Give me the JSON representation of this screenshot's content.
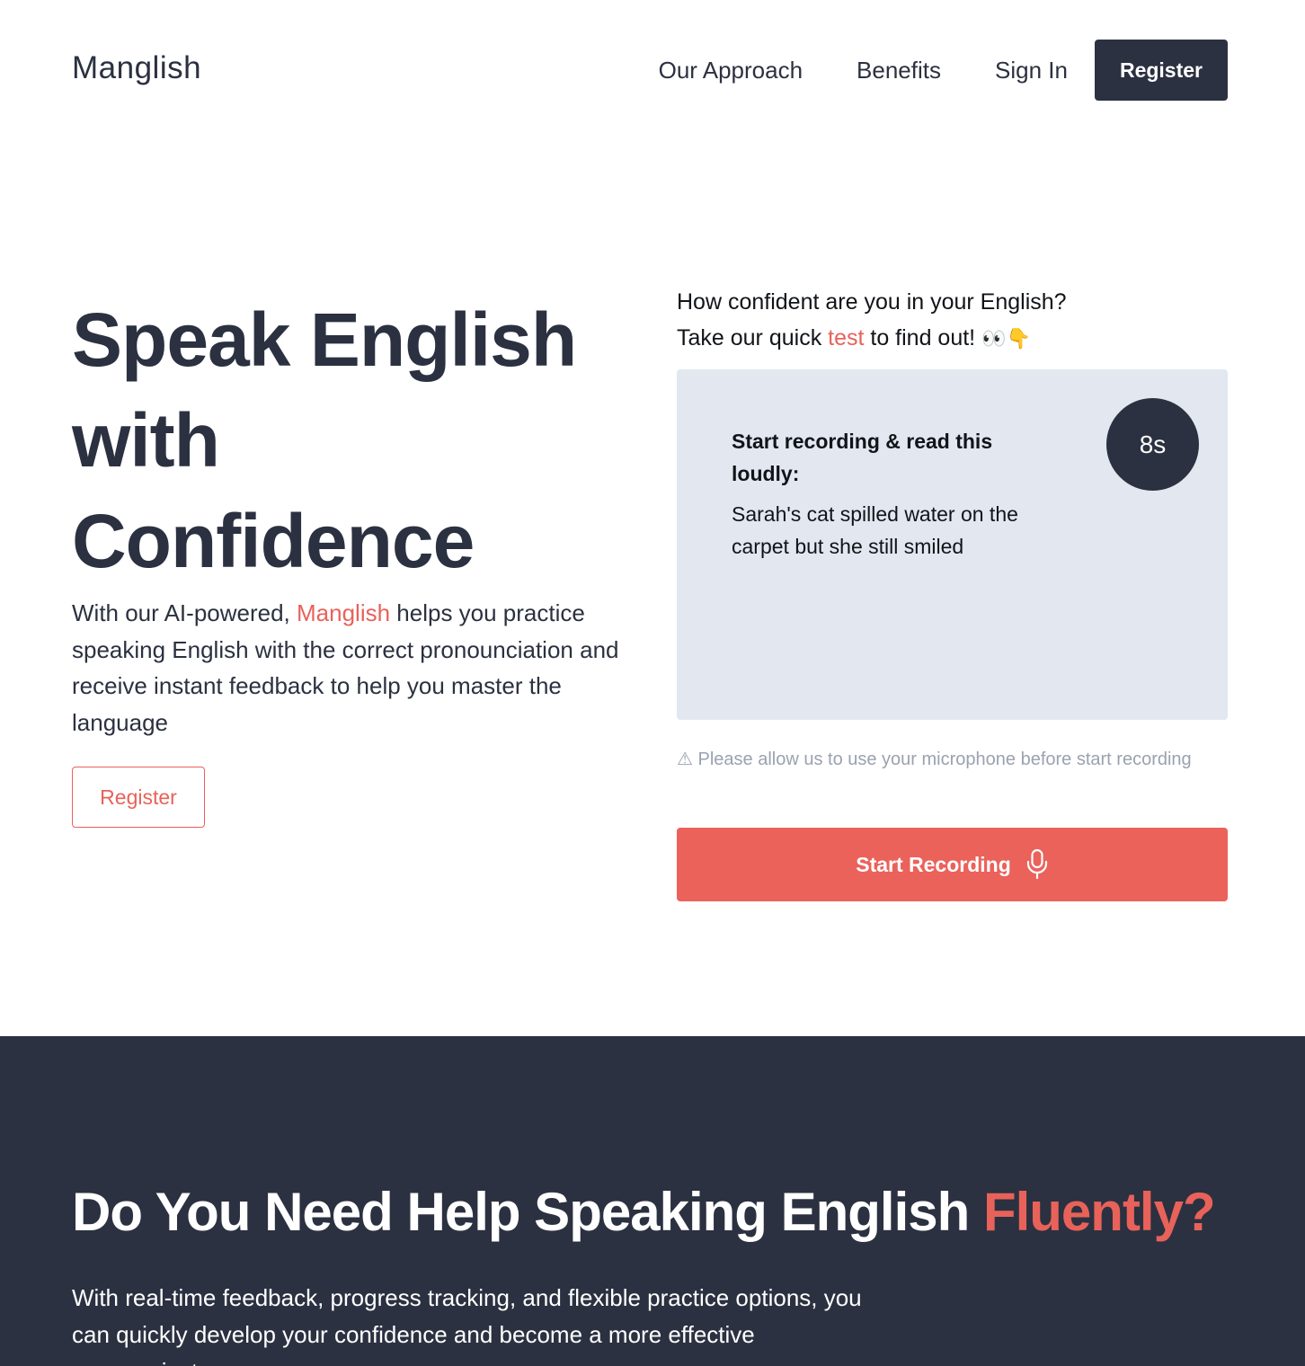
{
  "header": {
    "brand": "Manglish",
    "nav": {
      "approach": "Our Approach",
      "benefits": "Benefits",
      "signin": "Sign In",
      "register": "Register"
    }
  },
  "hero": {
    "title_line1": "Speak English",
    "title_line2": "with",
    "title_line3": "Confidence",
    "desc_before": "With our AI-powered, ",
    "desc_accent": "Manglish",
    "desc_after": " helps you practice speaking English with the correct pronounciation and receive instant feedback to help you master the language",
    "register_label": "Register"
  },
  "test": {
    "heading_line1": "How confident are you in your English?",
    "heading_line2_before": "Take our quick ",
    "heading_line2_accent": "test",
    "heading_line2_after": " to find out! ",
    "heading_emoji": "👀👇",
    "card_label": "Start recording & read this loudly:",
    "sentence": "Sarah's cat spilled water on the carpet but she still smiled",
    "timer": "8s",
    "warning_icon": "⚠",
    "warning": " Please allow us to use your microphone before start recording",
    "record_button": "Start Recording",
    "record_icon": "microphone-icon"
  },
  "section2": {
    "title_main": "Do You Need Help Speaking English ",
    "title_accent": "Fluently?",
    "desc": "With real-time feedback, progress tracking, and flexible practice options, you can quickly develop your confidence and become a more effective communicator."
  },
  "colors": {
    "dark": "#2b3140",
    "accent": "#e8625a",
    "card_bg": "#e2e7f0",
    "muted": "#9aa2af"
  }
}
